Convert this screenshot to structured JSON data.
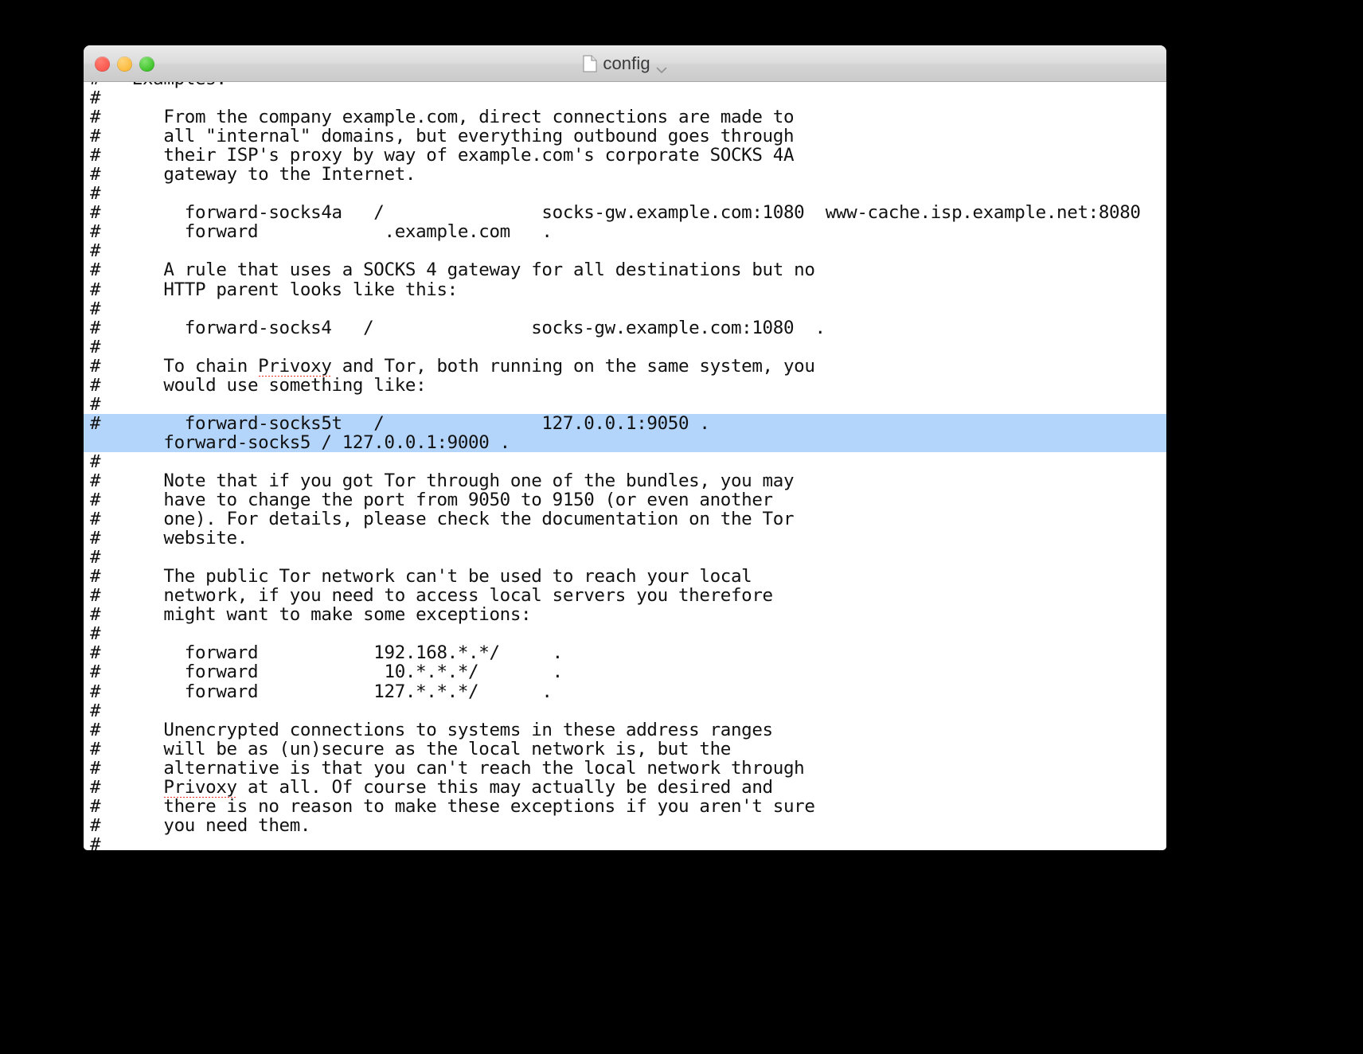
{
  "window": {
    "title": "config",
    "doc_icon": "document-icon",
    "chevron_icon": "chevron-down-icon",
    "traffic_lights": [
      {
        "name": "close-button",
        "label": "Close",
        "color": "#f9584f"
      },
      {
        "name": "minimize-button",
        "label": "Minimize",
        "color": "#fcbb3e"
      },
      {
        "name": "zoom-button",
        "label": "Zoom",
        "color": "#3fc229"
      }
    ]
  },
  "editor": {
    "selection_color": "#b4d5fb",
    "text_color": "#111111",
    "background_color": "#ffffff",
    "spellcheck_underline_color": "#e8342a",
    "lines": [
      {
        "text": "#   Examples:",
        "selected": false
      },
      {
        "text": "#",
        "selected": false
      },
      {
        "text": "#      From the company example.com, direct connections are made to",
        "selected": false
      },
      {
        "text": "#      all \"internal\" domains, but everything outbound goes through",
        "selected": false
      },
      {
        "text": "#      their ISP's proxy by way of example.com's corporate SOCKS 4A",
        "selected": false
      },
      {
        "text": "#      gateway to the Internet.",
        "selected": false
      },
      {
        "text": "#",
        "selected": false
      },
      {
        "text": "#        forward-socks4a   /               socks-gw.example.com:1080  www-cache.isp.example.net:8080",
        "selected": false
      },
      {
        "text": "#        forward            .example.com   .",
        "selected": false
      },
      {
        "text": "#",
        "selected": false
      },
      {
        "text": "#      A rule that uses a SOCKS 4 gateway for all destinations but no",
        "selected": false
      },
      {
        "text": "#      HTTP parent looks like this:",
        "selected": false
      },
      {
        "text": "#",
        "selected": false
      },
      {
        "text": "#        forward-socks4   /               socks-gw.example.com:1080  .",
        "selected": false
      },
      {
        "text": "#",
        "selected": false
      },
      {
        "text": "#      To chain Privoxy and Tor, both running on the same system, you",
        "selected": false,
        "misspell": "Privoxy"
      },
      {
        "text": "#      would use something like:",
        "selected": false
      },
      {
        "text": "#",
        "selected": false
      },
      {
        "text": "#        forward-socks5t   /               127.0.0.1:9050 .",
        "selected": true
      },
      {
        "text": "       forward-socks5 / 127.0.0.1:9000 .",
        "selected": true
      },
      {
        "text": "#",
        "selected": false
      },
      {
        "text": "#      Note that if you got Tor through one of the bundles, you may",
        "selected": false
      },
      {
        "text": "#      have to change the port from 9050 to 9150 (or even another",
        "selected": false
      },
      {
        "text": "#      one). For details, please check the documentation on the Tor",
        "selected": false
      },
      {
        "text": "#      website.",
        "selected": false
      },
      {
        "text": "#",
        "selected": false
      },
      {
        "text": "#      The public Tor network can't be used to reach your local",
        "selected": false
      },
      {
        "text": "#      network, if you need to access local servers you therefore",
        "selected": false
      },
      {
        "text": "#      might want to make some exceptions:",
        "selected": false
      },
      {
        "text": "#",
        "selected": false
      },
      {
        "text": "#        forward           192.168.*.*/     .",
        "selected": false
      },
      {
        "text": "#        forward            10.*.*.*/       .",
        "selected": false
      },
      {
        "text": "#        forward           127.*.*.*/      .",
        "selected": false
      },
      {
        "text": "#",
        "selected": false
      },
      {
        "text": "#      Unencrypted connections to systems in these address ranges",
        "selected": false
      },
      {
        "text": "#      will be as (un)secure as the local network is, but the",
        "selected": false
      },
      {
        "text": "#      alternative is that you can't reach the local network through",
        "selected": false
      },
      {
        "text": "#      Privoxy at all. Of course this may actually be desired and",
        "selected": false,
        "misspell": "Privoxy"
      },
      {
        "text": "#      there is no reason to make these exceptions if you aren't sure",
        "selected": false
      },
      {
        "text": "#      you need them.",
        "selected": false
      },
      {
        "text": "#",
        "selected": false
      }
    ]
  }
}
